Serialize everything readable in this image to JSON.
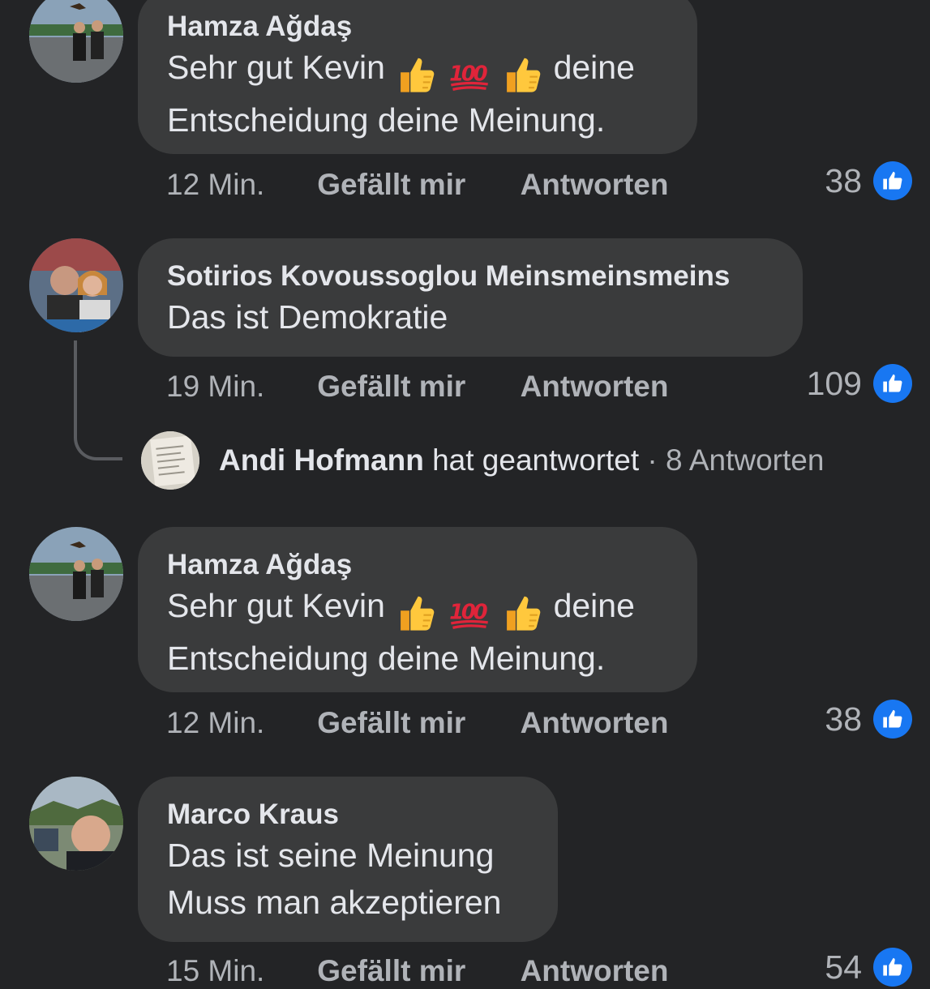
{
  "comments": [
    {
      "author": "Hamza Ağdaş",
      "line1_prefix": "Sehr gut Kevin",
      "line1_suffix": "deine",
      "line2": "Entscheidung deine Meinung.",
      "emojis": [
        "thumbs-up",
        "hundred-points",
        "thumbs-up"
      ],
      "time": "12 Min.",
      "like_label": "Gefällt mir",
      "reply_label": "Antworten",
      "like_count": "38"
    },
    {
      "author": "Sotirios Kovoussoglou Meinsmeinsmeins",
      "line1": "Das ist Demokratie",
      "time": "19 Min.",
      "like_label": "Gefällt mir",
      "reply_label": "Antworten",
      "like_count": "109",
      "replies": {
        "name": "Andi Hofmann",
        "action": " hat geantwortet",
        "count": " · 8 Antworten"
      }
    },
    {
      "author": "Hamza Ağdaş",
      "line1_prefix": "Sehr gut Kevin",
      "line1_suffix": "deine",
      "line2": "Entscheidung deine Meinung.",
      "emojis": [
        "thumbs-up",
        "hundred-points",
        "thumbs-up"
      ],
      "time": "12 Min.",
      "like_label": "Gefällt mir",
      "reply_label": "Antworten",
      "like_count": "38"
    },
    {
      "author": "Marco Kraus",
      "line1": "Das ist seine Meinung",
      "line2": "Muss man akzeptieren",
      "time": "15 Min.",
      "like_label": "Gefällt mir",
      "reply_label": "Antworten",
      "like_count": "54"
    }
  ],
  "colors": {
    "background": "#232426",
    "bubble": "#3a3b3c",
    "text": "#e4e6eb",
    "secondary_text": "#b0b3b8",
    "like_blue": "#1877f2"
  }
}
